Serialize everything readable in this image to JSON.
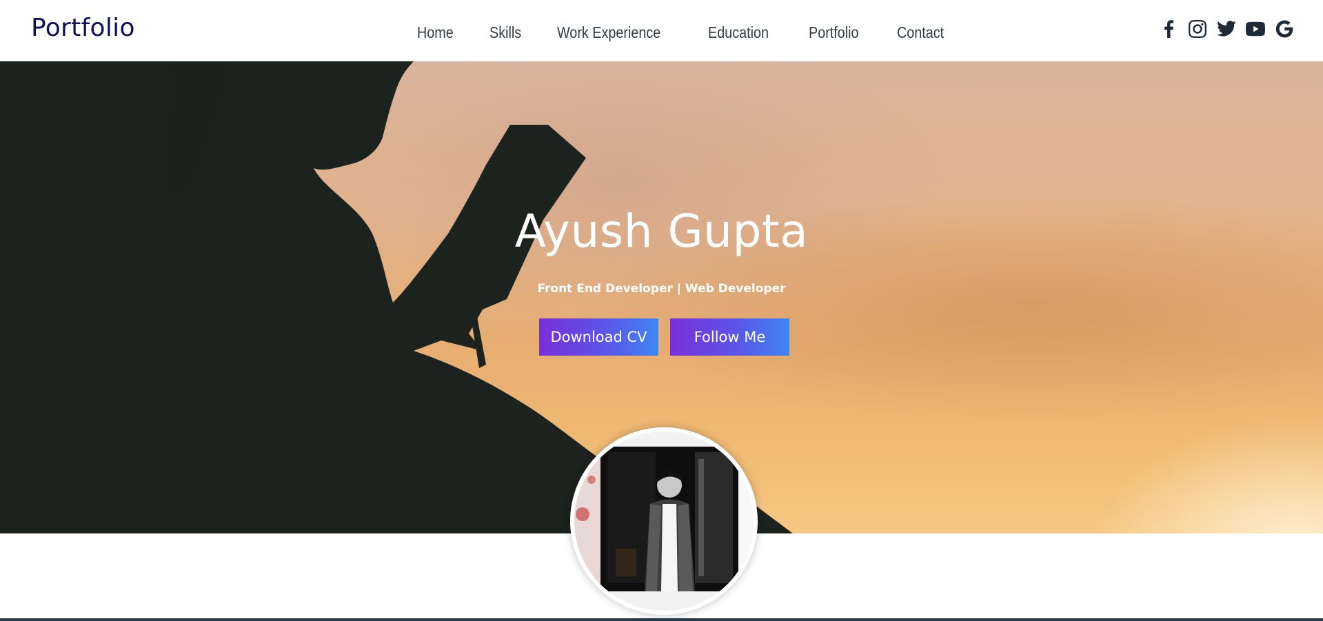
{
  "header": {
    "logo": "Portfolio",
    "nav": [
      "Home",
      "Skills",
      "Work Experience",
      "Education",
      "Portfolio",
      "Contact"
    ],
    "socials": [
      "facebook-icon",
      "instagram-icon",
      "twitter-icon",
      "youtube-icon",
      "google-icon"
    ]
  },
  "hero": {
    "title": "Ayush Gupta",
    "subtitle": "Front End Developer | Web Developer",
    "download_label": "Download CV",
    "follow_label": "Follow Me"
  },
  "colors": {
    "logo": "#12105a",
    "nav_text": "#333a44",
    "button_gradient_start": "#7a2fd8",
    "button_gradient_end": "#3f86f5",
    "silhouette": "#1c221e"
  }
}
